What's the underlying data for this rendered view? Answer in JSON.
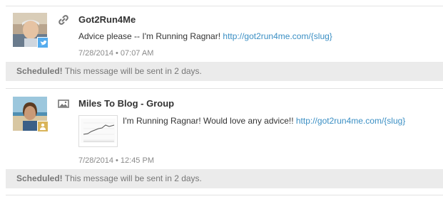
{
  "posts": [
    {
      "type_icon": "link-icon",
      "network_icon": "twitter-icon",
      "author": "Got2Run4Me",
      "text": "Advice please -- I'm Running Ragnar! ",
      "link": "http://got2run4me.com/{slug}",
      "timestamp": "7/28/2014 • 07:07 AM",
      "status_strong": "Scheduled!",
      "status_text": " This message will be sent in 2 days."
    },
    {
      "type_icon": "image-icon",
      "network_icon": "linkedin-icon",
      "author": "Miles To Blog - Group",
      "text": "I'm Running Ragnar! Would love any advice!! ",
      "link": "http://got2run4me.com/{slug}",
      "timestamp": "7/28/2014 • 12:45 PM",
      "status_strong": "Scheduled!",
      "status_text": " This message will be sent in 2 days."
    }
  ],
  "colors": {
    "link": "#3b8fc4",
    "twitter": "#55acee",
    "linkedin": "#d9b45a",
    "banner_bg": "#ebebeb"
  }
}
